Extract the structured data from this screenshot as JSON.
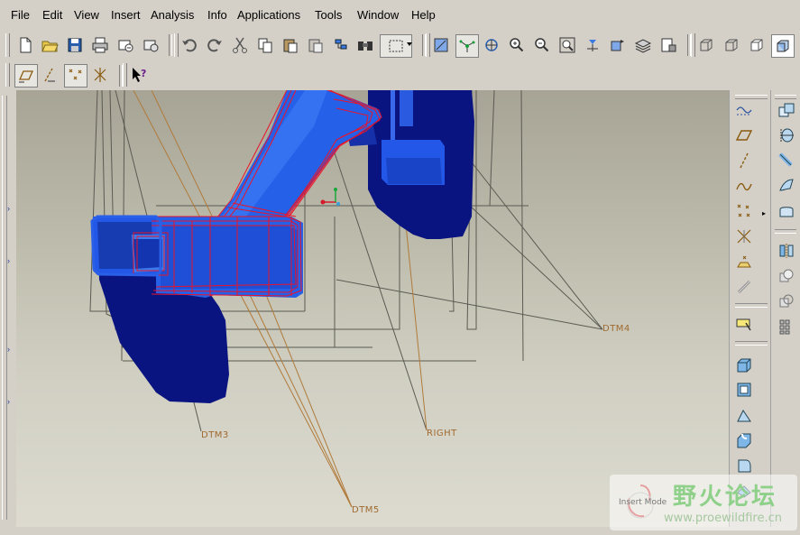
{
  "menu": [
    "File",
    "Edit",
    "View",
    "Insert",
    "Analysis",
    "Info",
    "Applications",
    "Tools",
    "Window",
    "Help"
  ],
  "toolbar1": {
    "file_tools": [
      "new-icon",
      "open-icon",
      "save-icon",
      "print-icon",
      "send-mail-icon",
      "email-icon"
    ],
    "edit_tools": [
      "undo-icon",
      "redo-icon",
      "cut-icon",
      "copy-icon",
      "paste-icon",
      "paste-special-icon",
      "regenerate-icon",
      "find-icon",
      "select-box-icon"
    ],
    "view_tools": [
      "repaint-icon",
      "spin-center-icon",
      "orient-icon",
      "zoom-in-icon",
      "zoom-out-icon",
      "refit-icon",
      "reorient-icon",
      "saved-views-icon",
      "layers-icon",
      "view-manager-icon"
    ],
    "display_tools": [
      "wireframe-icon",
      "hidden-line-icon",
      "no-hidden-icon",
      "shading-icon"
    ]
  },
  "toolbar2": {
    "datum_display": [
      "datum-plane-display-icon",
      "datum-axis-display-icon",
      "datum-point-display-icon",
      "coordinate-system-display-icon"
    ],
    "help": "context-help-icon"
  },
  "viewport": {
    "datum_labels": [
      "DTM4",
      "DTM3",
      "RIGHT",
      "DTM5"
    ]
  },
  "right_toolbar_datum": [
    "sketched-curve-icon",
    "datum-plane-icon",
    "datum-axis-icon",
    "datum-curve-icon",
    "datum-point-icon",
    "offset-point-icon",
    "field-point-icon",
    "coordinate-system-icon",
    "analysis-feature-icon",
    "extrude-tool-icon",
    "hole-tool-icon",
    "draft-tool-icon",
    "round-tool-icon",
    "shell-tool-icon"
  ],
  "right_toolbar_features": [
    "copy-feature-icon",
    "revolve-icon",
    "sweep-icon",
    "blend-icon",
    "boundary-blend-icon",
    "mirror-icon",
    "merge-icon",
    "trim-icon",
    "pattern-icon"
  ],
  "watermark": {
    "mode": "Insert Mode",
    "site_name": "野火论坛",
    "url": "www.proewildfire.cn"
  },
  "colors": {
    "part_dark_blue": "#0a1480",
    "part_bright_blue": "#2257e8",
    "highlight_red": "#e8142a",
    "datum_plane": "#5a5a52",
    "datum_label": "#a06a30"
  }
}
